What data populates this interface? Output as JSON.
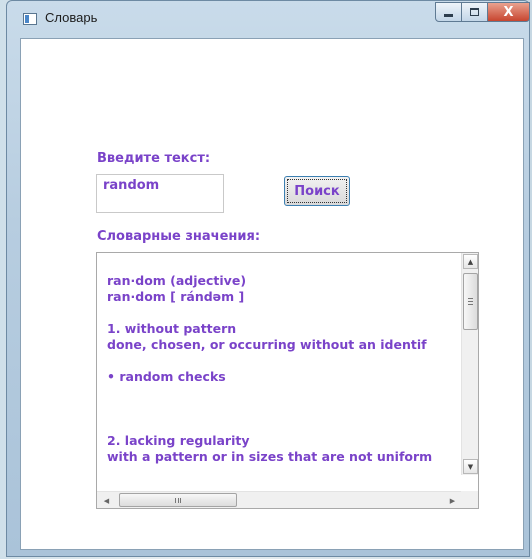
{
  "window": {
    "title": "Словарь",
    "controls": {
      "minimize_icon": "minimize-icon",
      "maximize_icon": "maximize-icon",
      "close_icon": "close-icon",
      "close_glyph": "X"
    }
  },
  "form": {
    "input_label": "Введите текст:",
    "input_value": "random",
    "search_button": "Поиск",
    "results_label": "Словарные значения:"
  },
  "results": {
    "lines": [
      "ran·dom (adjective)",
      "ran·dom [ rándəm ]",
      "",
      "1. without pattern",
      "done, chosen, or occurring without an identif",
      "",
      "• random checks",
      "",
      "",
      "",
      "2. lacking regularity",
      "with a pattern or in sizes that are not uniform"
    ],
    "scroll_grip": "III"
  },
  "colors": {
    "accent_text": "#7a43c9",
    "close_button": "#c7452f"
  }
}
